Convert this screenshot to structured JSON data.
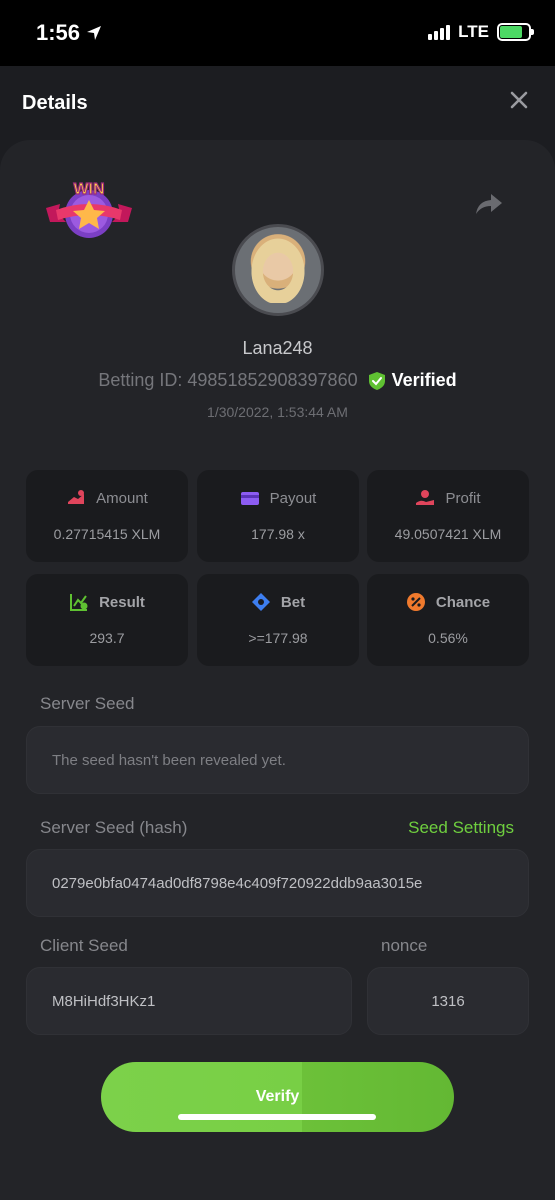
{
  "status_bar": {
    "time": "1:56",
    "network": "LTE"
  },
  "header": {
    "title": "Details",
    "close_icon": "close-icon"
  },
  "profile": {
    "username": "Lana248",
    "betting_id": "Betting ID: 49851852908397860",
    "verified_label": "Verified",
    "timestamp": "1/30/2022, 1:53:44 AM",
    "badge_text": "WIN"
  },
  "stats": [
    {
      "label": "Amount",
      "value": "0.27715415 XLM",
      "icon": "amount-icon",
      "color": "#e0455c"
    },
    {
      "label": "Payout",
      "value": "177.98 x",
      "icon": "payout-icon",
      "color": "#8c5cf2"
    },
    {
      "label": "Profit",
      "value": "49.0507421 XLM",
      "icon": "profit-icon",
      "color": "#e0455c"
    },
    {
      "label": "Result",
      "value": "293.7",
      "icon": "result-icon",
      "color": "#5fc132"
    },
    {
      "label": "Bet",
      "value": ">=177.98",
      "icon": "bet-icon",
      "color": "#3d7ef0"
    },
    {
      "label": "Chance",
      "value": "0.56%",
      "icon": "chance-icon",
      "color": "#f07a2d"
    }
  ],
  "server_seed": {
    "label": "Server Seed",
    "value": "The seed hasn't been revealed yet."
  },
  "server_seed_hash": {
    "label": "Server Seed (hash)",
    "settings_link": "Seed Settings",
    "value": "0279e0bfa0474ad0df8798e4c409f720922ddb9aa3015e"
  },
  "client_seed": {
    "label": "Client Seed",
    "value": "M8HiHdf3HKz1"
  },
  "nonce": {
    "label": "nonce",
    "value": "1316"
  },
  "verify_button": {
    "label": "Verify"
  },
  "colors": {
    "accent_green": "#6fcf3f",
    "background": "#1c1d21",
    "sheet": "#232428"
  }
}
